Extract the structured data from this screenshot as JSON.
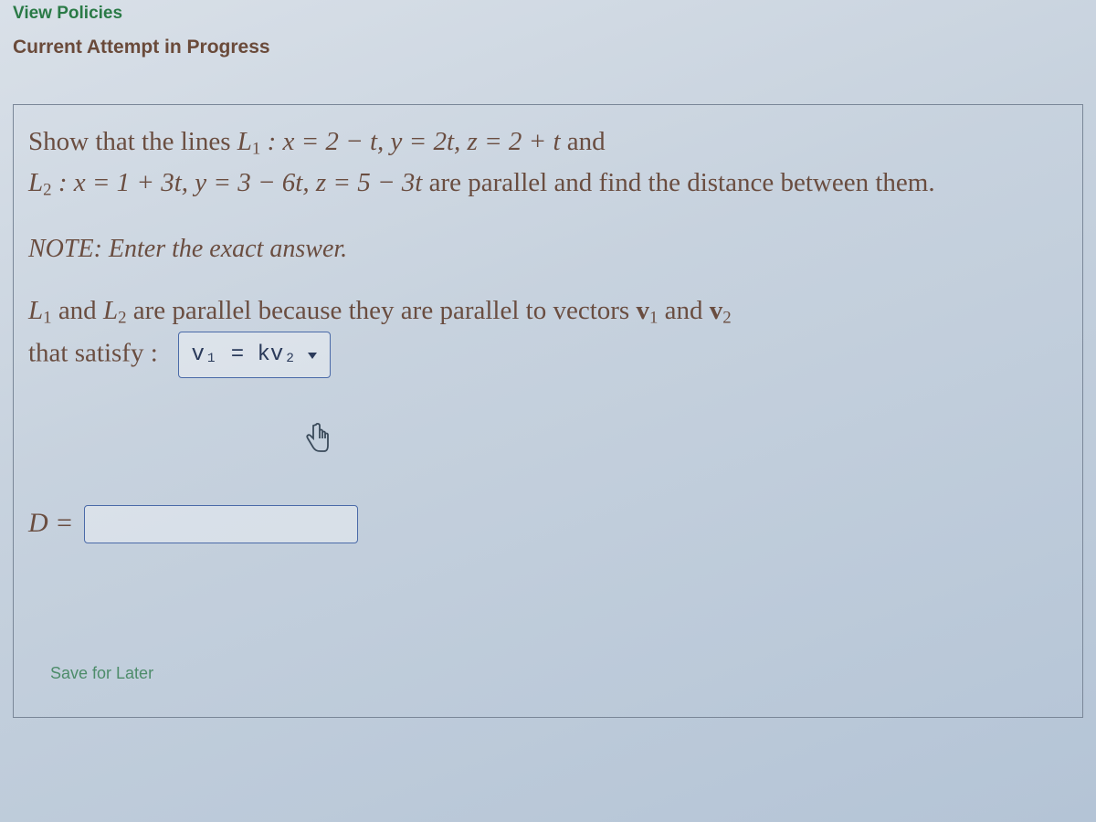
{
  "header": {
    "view_policies_link": "View Policies",
    "attempt_label": "Current Attempt in Progress"
  },
  "problem": {
    "intro": "Show that the lines ",
    "l1_label": "L",
    "l1_sub": "1",
    "l1_eq": " : x = 2 − t,  y = 2t,  z = 2 + t",
    "and": " and",
    "l2_label": "L",
    "l2_sub": "2",
    "l2_eq": " : x = 1 + 3t,  y = 3 − 6t,  z = 5 − 3t",
    "tail": " are parallel and find the distance between them.",
    "note": "NOTE: Enter the exact answer.",
    "explain_pre": " and ",
    "explain_post": " are parallel because they are parallel to vectors ",
    "v1": "v",
    "v1_sub": "1",
    "and2": " and ",
    "v2": "v",
    "v2_sub": "2",
    "satisfy": "that satisfy :",
    "dropdown_value": "v₁ = kv₂",
    "d_label": "D =",
    "d_value": ""
  },
  "footer": {
    "save_label": "Save for Later"
  }
}
